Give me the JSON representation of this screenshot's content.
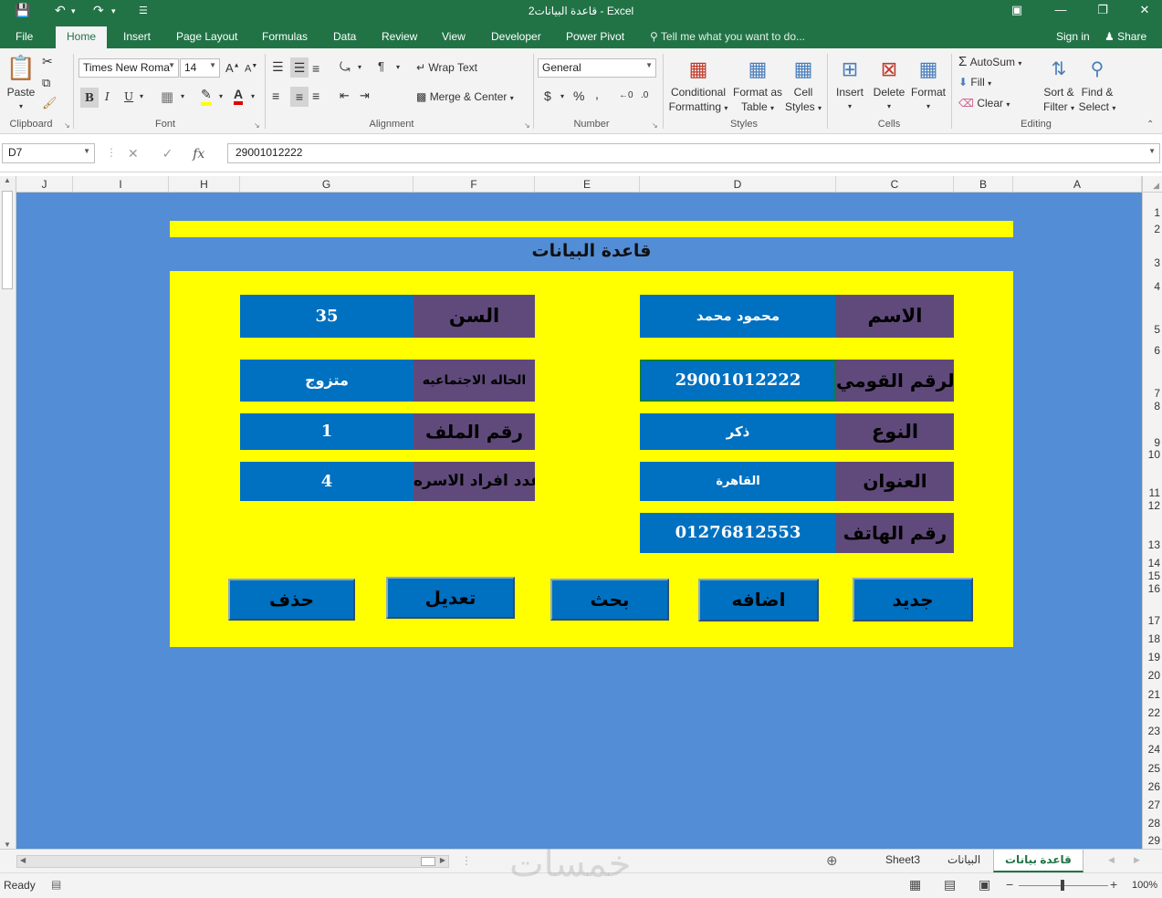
{
  "window": {
    "title": "قاعدة البيانات2 - Excel"
  },
  "quick_access": {
    "save_icon": "save-icon",
    "undo_icon": "undo-icon",
    "redo_icon": "redo-icon"
  },
  "tabs": [
    "File",
    "Home",
    "Insert",
    "Page Layout",
    "Formulas",
    "Data",
    "Review",
    "View",
    "Developer",
    "Power Pivot"
  ],
  "active_tab": "Home",
  "tell_me": "Tell me what you want to do...",
  "sign_in": "Sign in",
  "share": "Share",
  "ribbon": {
    "clipboard": {
      "label": "Clipboard",
      "paste": "Paste"
    },
    "font": {
      "label": "Font",
      "name": "Times New Roma",
      "size": "14",
      "bold": "B",
      "italic": "I",
      "underline": "U"
    },
    "alignment": {
      "label": "Alignment",
      "wrap": "Wrap Text",
      "merge": "Merge & Center"
    },
    "number": {
      "label": "Number",
      "format": "General",
      "currency": "$",
      "percent": "%",
      "comma": ","
    },
    "styles": {
      "label": "Styles",
      "conditional_1": "Conditional",
      "conditional_2": "Formatting",
      "format_table_1": "Format as",
      "format_table_2": "Table",
      "cell_styles_1": "Cell",
      "cell_styles_2": "Styles"
    },
    "cells": {
      "label": "Cells",
      "insert": "Insert",
      "delete": "Delete",
      "format": "Format"
    },
    "editing": {
      "label": "Editing",
      "autosum": "AutoSum",
      "fill": "Fill",
      "clear": "Clear",
      "sort_1": "Sort &",
      "sort_2": "Filter",
      "find_1": "Find &",
      "find_2": "Select"
    }
  },
  "formula_bar": {
    "name_box": "D7",
    "fx": "fx",
    "value": "29001012222"
  },
  "columns": [
    "J",
    "I",
    "H",
    "G",
    "F",
    "E",
    "D",
    "C",
    "B",
    "A"
  ],
  "rows": [
    "1",
    "2",
    "3",
    "4",
    "5",
    "6",
    "7",
    "8",
    "9",
    "10",
    "11",
    "12",
    "13",
    "14",
    "15",
    "16",
    "17",
    "18",
    "19",
    "20",
    "21",
    "22",
    "23",
    "24",
    "25",
    "26",
    "27",
    "28",
    "29"
  ],
  "form": {
    "title": "قاعدة البيانات",
    "fields_right": [
      {
        "label": "الاسم",
        "value": "محمود محمد"
      },
      {
        "label": "الرقم القومي",
        "value": "29001012222"
      },
      {
        "label": "النوع",
        "value": "ذكر"
      },
      {
        "label": "العنوان",
        "value": "القاهرة"
      },
      {
        "label": "رقم الهاتف",
        "value": "01276812553"
      }
    ],
    "fields_left": [
      {
        "label": "السن",
        "value": "35"
      },
      {
        "label": "الحاله الاجتماعيه",
        "value": "متزوج"
      },
      {
        "label": "رقم الملف",
        "value": "1"
      },
      {
        "label": "عدد افراد الاسره",
        "value": "4"
      }
    ],
    "buttons": {
      "new": "جديد",
      "add": "اضافه",
      "search": "بحث",
      "edit": "تعديل",
      "delete": "حذف"
    }
  },
  "sheet_tabs": [
    "Sheet3",
    "البيانات",
    "قاعدة بيانات"
  ],
  "active_sheet": "قاعدة بيانات",
  "status": {
    "ready": "Ready",
    "zoom": "100%"
  },
  "watermark": "خمسات",
  "colors": {
    "excel_green": "#217346",
    "sheet_blue": "#538dd5",
    "panel_yellow": "#ffff00",
    "label_purple": "#604a7b",
    "value_blue": "#0070c0"
  }
}
